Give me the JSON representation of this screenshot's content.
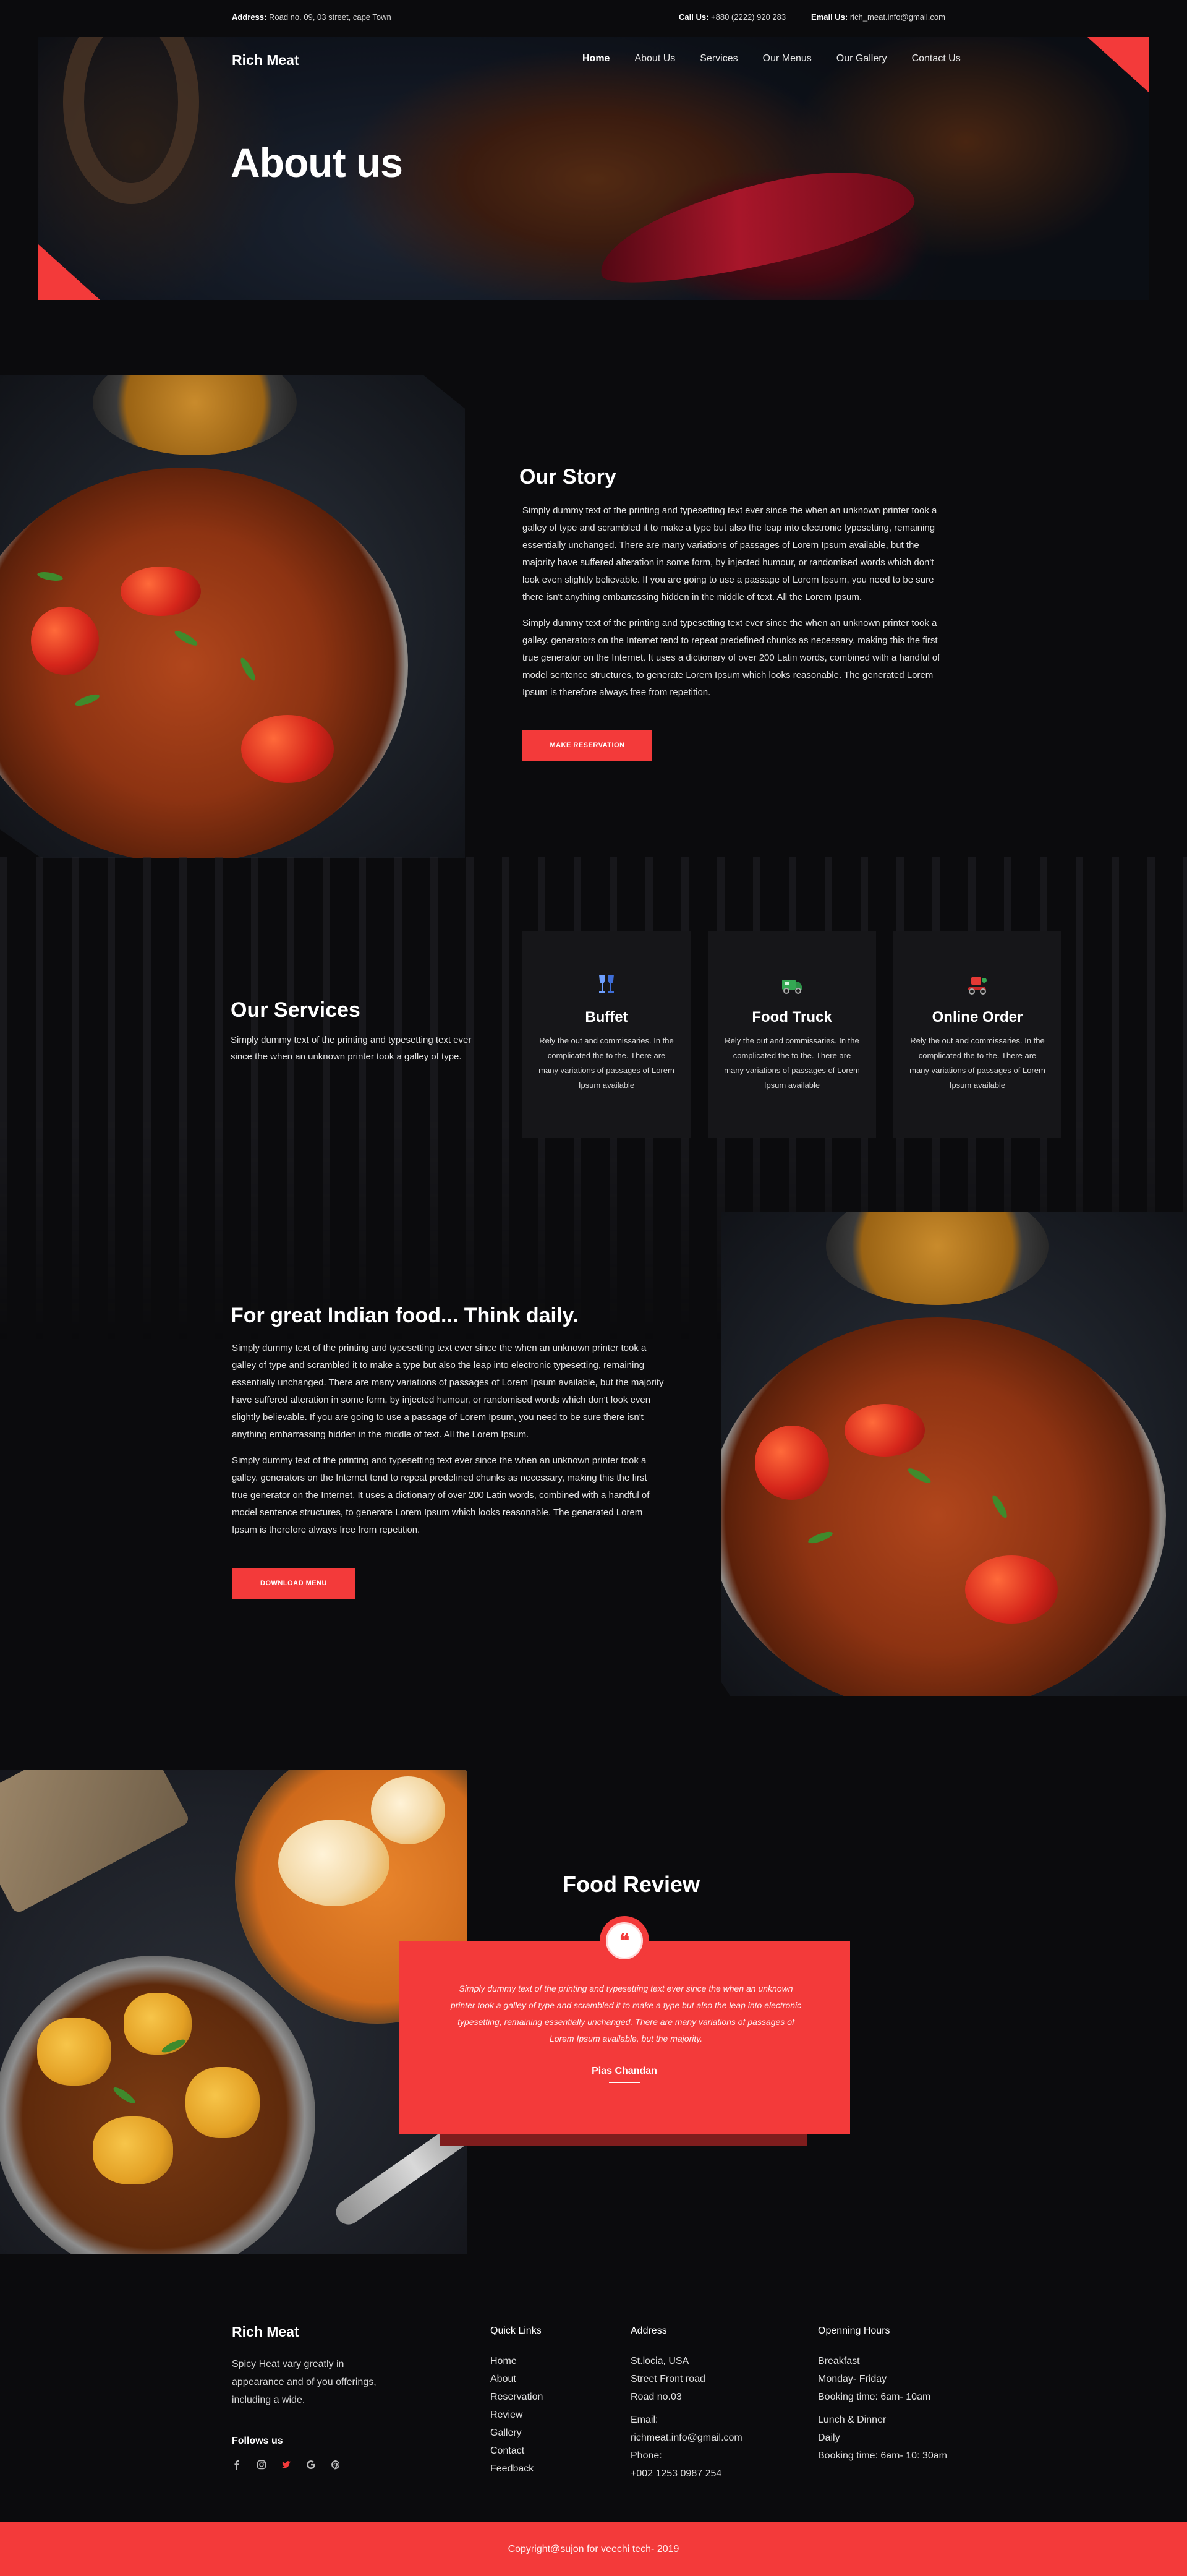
{
  "topbar": {
    "address_label": "Address:",
    "address_value": "Road no. 09, 03 street, cape Town",
    "call_label": "Call Us:",
    "call_value": "+880 (2222) 920 283",
    "email_label": "Email Us:",
    "email_value": "rich_meat.info@gmail.com"
  },
  "header": {
    "brand": "Rich Meat",
    "nav": [
      "Home",
      "About Us",
      "Services",
      "Our Menus",
      "Our Gallery",
      "Contact Us"
    ],
    "active_nav": "Home"
  },
  "hero": {
    "title": "About us"
  },
  "story": {
    "title": "Our Story",
    "p1": "Simply dummy text of the printing and typesetting text ever since the when an unknown printer took a galley of type and scrambled it to make a type but also the leap into electronic typesetting, remaining essentially unchanged. There are many variations of passages of Lorem Ipsum available, but the majority have suffered alteration in some form, by injected humour, or randomised words which don't look even slightly believable. If you are going to use a passage of Lorem Ipsum, you need to be sure there isn't anything embarrassing hidden in the middle of text. All the Lorem Ipsum.",
    "p2": "Simply dummy text of the printing and typesetting text ever since the when an unknown printer took a galley. generators on the Internet tend to repeat predefined chunks as necessary, making this the first true generator on the Internet. It uses a dictionary of over 200 Latin words, combined with a handful of model sentence structures, to generate Lorem Ipsum which looks reasonable. The generated Lorem Ipsum is therefore always free from repetition.",
    "button": "MAKE RESERVATION"
  },
  "services": {
    "title": "Our Services",
    "subtitle": "Simply dummy text of the printing and typesetting text ever since the when an unknown printer took a galley of type.",
    "cards": [
      {
        "icon": "wine-glass-icon",
        "title": "Buffet",
        "text": "Rely the out and commissaries. In the complicated the to the. There are many variations of passages of Lorem Ipsum available"
      },
      {
        "icon": "food-truck-icon",
        "title": "Food Truck",
        "text": "Rely the out and commissaries. In the complicated the to the. There are many variations of passages of Lorem Ipsum available"
      },
      {
        "icon": "delivery-scooter-icon",
        "title": "Online Order",
        "text": "Rely the out and commissaries. In the complicated the to the. There are many variations of passages of Lorem Ipsum available"
      }
    ]
  },
  "indian": {
    "title": "For great Indian food... Think daily.",
    "p1": "Simply dummy text of the printing and typesetting text ever since the when an unknown printer took a galley of type and scrambled it to make a type but also the leap into electronic typesetting, remaining essentially unchanged. There are many variations of passages of Lorem Ipsum available, but the majority have suffered alteration in some form, by injected humour, or randomised words which don't look even slightly believable. If you are going to use a passage of Lorem Ipsum, you need to be sure there isn't anything embarrassing hidden in the middle of text. All the Lorem Ipsum.",
    "p2": "Simply dummy text of the printing and typesetting text ever since the when an unknown printer took a galley. generators on the Internet tend to repeat predefined chunks as necessary, making this the first true generator on the Internet. It uses a dictionary of over 200 Latin words, combined with a handful of model sentence structures, to generate Lorem Ipsum which looks reasonable. The generated Lorem Ipsum is therefore always free from repetition.",
    "button": "DOWNLOAD MENU"
  },
  "review": {
    "title": "Food Review",
    "text": "Simply dummy text of the printing and typesetting text ever since the when an unknown printer took a galley of type and scrambled it to make a type but also the leap into electronic typesetting, remaining essentially unchanged. There are many variations of passages of Lorem Ipsum available, but the majority.",
    "name": "Pias Chandan"
  },
  "footer": {
    "brand": "Rich Meat",
    "description": "Spicy Heat vary greatly in appearance and of you offerings, including a wide.",
    "follow": "Follows us",
    "socials": [
      "facebook-icon",
      "instagram-icon",
      "twitter-icon",
      "google-icon",
      "pinterest-icon"
    ],
    "quick_links_title": "Quick Links",
    "quick_links": [
      "Home",
      "About",
      "Reservation",
      "Review",
      "Gallery",
      "Contact",
      "Feedback"
    ],
    "address_title": "Address",
    "address_lines": [
      "St.locia, USA",
      "Street Front road",
      "Road no.03"
    ],
    "email_label": "Email:",
    "email": "richmeat.info@gmail.com",
    "phone_label": "Phone:",
    "phone": "+002 1253 0987 254",
    "hours_title": "Openning Hours",
    "breakfast": [
      "Breakfast",
      "Monday- Friday",
      "Booking time: 6am- 10am"
    ],
    "lunch": [
      "Lunch & Dinner",
      "Daily",
      "Booking time: 6am- 10: 30am"
    ],
    "copyright": "Copyright@sujon for veechi tech- 2019"
  },
  "colors": {
    "accent": "#f33a3a",
    "background": "#0b0b0d",
    "card": "#161619"
  }
}
